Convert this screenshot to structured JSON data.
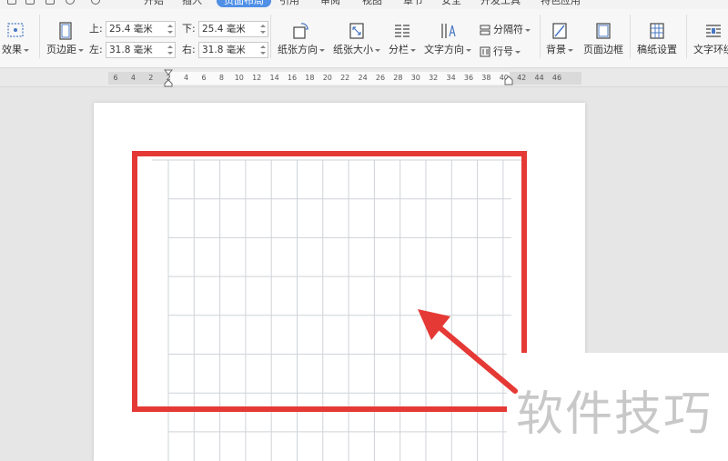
{
  "menu": {
    "tabs": [
      "开始",
      "插入",
      "页面布局",
      "引用",
      "审阅",
      "视图",
      "章节",
      "安全",
      "开发工具",
      "特色应用"
    ],
    "active_tab": "页面布局"
  },
  "ribbon": {
    "effects_label": "效果",
    "margins_label": "页边距",
    "margins": {
      "top_label": "上:",
      "top_value": "25.4 毫米",
      "bottom_label": "下:",
      "bottom_value": "25.4 毫米",
      "left_label": "左:",
      "left_value": "31.8 毫米",
      "right_label": "右:",
      "right_value": "31.8 毫米"
    },
    "orientation_label": "纸张方向",
    "size_label": "纸张大小",
    "columns_label": "分栏",
    "text_direction_label": "文字方向",
    "separator_label": "分隔符",
    "line_numbers_label": "行号",
    "background_label": "背景",
    "page_border_label": "页面边框",
    "manuscript_label": "稿纸设置",
    "wrap_text_label": "文字环绕"
  },
  "ruler": {
    "ticks": [
      "6",
      "4",
      "2",
      "2",
      "4",
      "6",
      "8",
      "10",
      "12",
      "14",
      "16",
      "18",
      "20",
      "22",
      "24",
      "26",
      "28",
      "30",
      "32",
      "34",
      "36",
      "38",
      "40",
      "42",
      "44",
      "46"
    ]
  },
  "watermark": "软件技巧",
  "colors": {
    "highlight": "#e53935",
    "active_tab": "#4f8fe6",
    "grid_line": "#cfd3d8"
  }
}
